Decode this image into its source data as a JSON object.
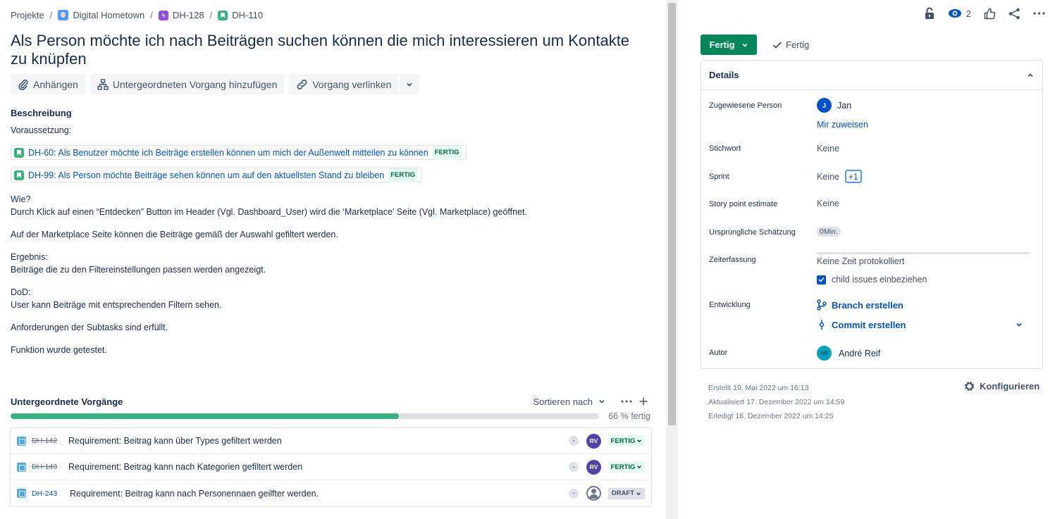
{
  "breadcrumb": {
    "projects": "Projekte",
    "project": "Digital Hometown",
    "epic": "DH-128",
    "issue": "DH-110",
    "separator": "/"
  },
  "issue": {
    "title": "Als Person möchte ich nach Beiträgen suchen können die mich interessieren um Kontakte zu knüpfen"
  },
  "actions": {
    "attach": "Anhängen",
    "add_child": "Untergeordneten Vorgang hinzufügen",
    "link_issue": "Vorgang verlinken"
  },
  "description": {
    "label": "Beschreibung",
    "precondition": "Voraussetzung:",
    "linked": [
      {
        "text": "DH-60: Als Benutzer möchte ich Beiträge erstellen können um mich der Außenwelt mitteilen zu können",
        "status": "FERTIG"
      },
      {
        "text": "DH-99: Als Person möchte Beiträge sehen können um auf den aktuellsten Stand zu bleiben",
        "status": "FERTIG"
      }
    ],
    "how_label": "Wie?",
    "how_text": "Durch Klick auf einen “Entdecken” Button im Header (Vgl. Dashboard_User) wird die ‘Marketplace’ Seite (Vgl. Marketplace) geöffnet.",
    "filter_text": "Auf der Marketplace Seite können die Beiträge gemäß der Auswahl gefiltert werden.",
    "result_label": "Ergebnis:",
    "result_text": "Beiträge die zu den Filtereinstellungen passen werden angezeigt.",
    "dod_label": "DoD:",
    "dod_text": "User kann Beiträge mit entsprechenden Filtern sehen.",
    "req_text": "Anforderungen der Subtasks sind erfüllt.",
    "tested_text": "Funktion wurde getestet."
  },
  "subtasks": {
    "title": "Untergeordnete Vorgänge",
    "sort_label": "Sortieren nach",
    "progress_percent": 66,
    "progress_label": "66 % fertig",
    "items": [
      {
        "key": "DH-142",
        "summary": "Requirement: Beitrag kann über Types gefiltert werden",
        "priority": "-",
        "assignee": "RV",
        "status": "FERTIG"
      },
      {
        "key": "DH-143",
        "summary": "Requirement: Beitrag kann nach Kategorien gefiltert werden",
        "priority": "-",
        "assignee": "RV",
        "status": "FERTIG"
      },
      {
        "key": "DH-243",
        "summary": "Requirement: Beitrag kann nach Personennaen geilfter werden.",
        "priority": "-",
        "assignee": "",
        "status": "DRAFT"
      }
    ]
  },
  "sidebar": {
    "watchers_count": "2",
    "status_button": "Fertig",
    "resolution": "Fertig",
    "details_title": "Details",
    "fields": {
      "assignee_label": "Zugewiesene Person",
      "assignee_initial": "J",
      "assignee_name": "Jan",
      "assign_to_me": "Mir zuweisen",
      "labels_label": "Stichwort",
      "labels_value": "Keine",
      "sprint_label": "Sprint",
      "sprint_value": "Keine",
      "sprint_badge": "+1",
      "story_points_label": "Story point estimate",
      "story_points_value": "Keine",
      "original_estimate_label": "Ursprüngliche Schätzung",
      "original_estimate_value": "0Min.",
      "time_tracking_label": "Zeiterfassung",
      "time_tracking_value": "Keine Zeit protokolliert",
      "child_issues_label": "child issues einbeziehen",
      "development_label": "Entwicklung",
      "create_branch": "Branch erstellen",
      "create_commit": "Commit erstellen",
      "reporter_label": "Autor",
      "reporter_initials": "AR",
      "reporter_name": "André Reif"
    },
    "created": "Erstellt 19. Mai 2022 um 16:13",
    "updated": "Aktualisiert 17. Dezember 2022 um 14:59",
    "resolved": "Erledigt 16. Dezember 2022 um 14:25",
    "configure": "Konfigurieren"
  }
}
